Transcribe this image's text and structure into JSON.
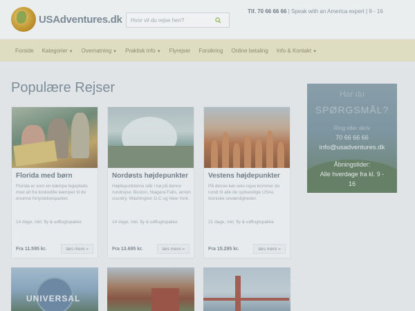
{
  "header": {
    "logo_text": "USAdventures.dk",
    "search_placeholder": "Hvor vil du rejse hen?",
    "phone": "Tlf. 70 66 66 66",
    "contact_rest": " | Speak with an America expert | 9 - 16"
  },
  "nav": {
    "items": [
      {
        "label": "Forside",
        "caret": false
      },
      {
        "label": "Kategorier",
        "caret": true
      },
      {
        "label": "Overnatning",
        "caret": true
      },
      {
        "label": "Praktisk info",
        "caret": true
      },
      {
        "label": "Flyrejser",
        "caret": false
      },
      {
        "label": "Forsikring",
        "caret": false
      },
      {
        "label": "Online betaling",
        "caret": false
      },
      {
        "label": "Info & Kontakt",
        "caret": true
      }
    ]
  },
  "main": {
    "title": "Populære Rejser",
    "cards": [
      {
        "title": "Florida med børn",
        "desc": "Florida er som en kæmpe legeplads med alt fra krokodille kæmper til de enorme forlystelsesparker.",
        "meta": "14 dage, inkl. fly & udflugtspakke",
        "price": "Fra 11.595 kr.",
        "button": "læs mere »"
      },
      {
        "title": "Nordøsts højdepunkter",
        "desc": "Højdepunkterne står i kø på denne rundrejse: Boston, Niagara Falls, amish country, Washington D.C og New York.",
        "meta": "14 dage, inkl. fly & udflugtspakke",
        "price": "Fra 13.695 kr.",
        "button": "læs mere »"
      },
      {
        "title": "Vestens højdepunkter",
        "desc": "På denne kør-selv-rejse kommer du rundt til alle de sydvestlige USAs ikoniske seværdigheder.",
        "meta": "21 dage, inkl. fly & udflugtspakke",
        "price": "Fra 15.295 kr.",
        "button": "læs mere »"
      }
    ],
    "row2": {
      "universal_text": "UNIVERSAL"
    }
  },
  "sidebar": {
    "line1": "Har du",
    "line2": "SPØRGSMÅL?",
    "line3": "Ring eller skriv",
    "line4": "70 66 66 66",
    "line5": "info@usadventures.dk",
    "line6": "Åbningstider:",
    "line7": "Alle hverdage fra kl. 9 -",
    "line8": "16"
  },
  "colors": {
    "nav_bg": "#ece7c8",
    "accent_green": "#9bbf55",
    "title": "#7d8e9a"
  }
}
